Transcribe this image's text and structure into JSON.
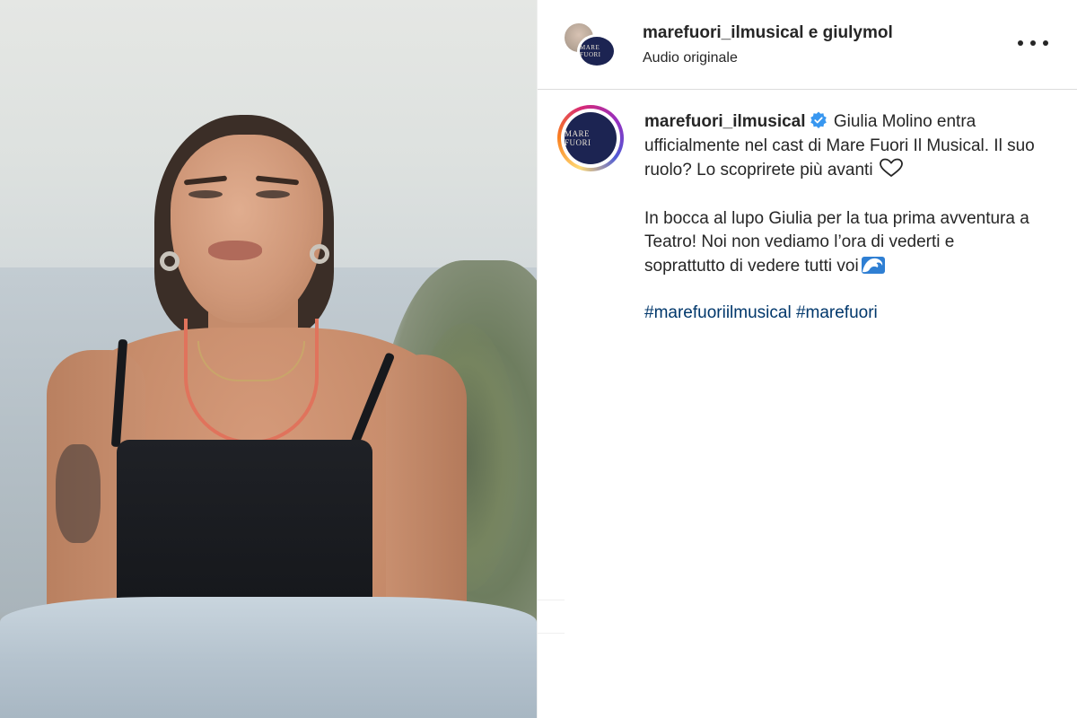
{
  "header": {
    "users": "marefuori_ilmusical e giulymol",
    "audio": "Audio originale",
    "avatar_logo_text": "MARE FUORI",
    "more_icon": "more-options-icon"
  },
  "post": {
    "username": "marefuori_ilmusical",
    "verified_icon": "verified-badge-icon",
    "caption_line1": "Giulia Molino entra ufficialmente nel cast di Mare Fuori Il Musical. Il suo ruolo? Lo scoprirete più avanti",
    "heart_icon": "heart-outline-icon",
    "caption_line2": "In bocca al lupo Giulia per la tua prima avventura a Teatro! Noi non vediamo l’ora di vederti e soprattutto di vedere tutti voi",
    "wave_icon": "wave-emoji-icon",
    "hashtags": [
      "#marefuoriilmusical",
      "#marefuori"
    ],
    "logo_text": "MARE FUORI"
  },
  "colors": {
    "text": "#262626",
    "hashtag": "#00376b",
    "verified": "#3897f0",
    "logo_bg": "#1c2452"
  }
}
